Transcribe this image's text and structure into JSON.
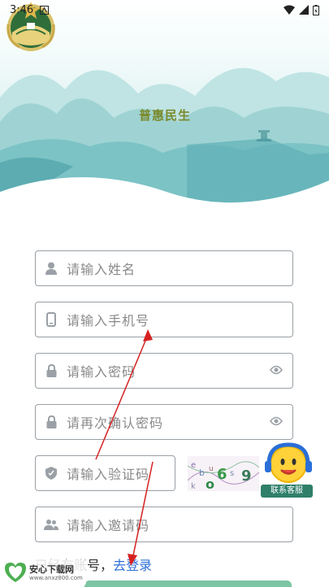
{
  "status": {
    "time": "3:46"
  },
  "brand": {
    "name": "普惠民生"
  },
  "form": {
    "name_placeholder": "请输入姓名",
    "phone_placeholder": "请输入手机号",
    "password_placeholder": "请输入密码",
    "confirm_placeholder": "请再次确认密码",
    "captcha_placeholder": "请输入验证码",
    "invite_placeholder": "请输入邀请码"
  },
  "captcha": {
    "chars": [
      "e",
      "b",
      "u",
      "6",
      "s",
      "9",
      "k",
      "o"
    ]
  },
  "service": {
    "label": "联系客服"
  },
  "footer": {
    "has_account": "已经有账号，",
    "login_link": "去登录"
  },
  "watermark": {
    "name": "安心下载网",
    "url": "www.anxz800.com"
  },
  "colors": {
    "accent": "#2d6fd6",
    "border": "#9aa0a6",
    "brand": "#7a8a2b"
  }
}
